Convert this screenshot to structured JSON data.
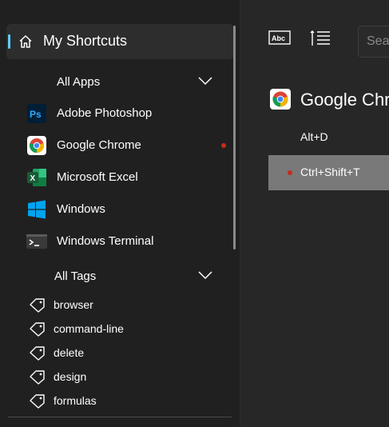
{
  "sidebar": {
    "home": {
      "label": "My Shortcuts",
      "icon": "home-icon"
    },
    "apps_group": {
      "label": "All Apps",
      "icon": "chevron-down-icon"
    },
    "apps": [
      {
        "label": "Adobe Photoshop",
        "icon": "photoshop-icon",
        "has_indicator": false
      },
      {
        "label": "Google Chrome",
        "icon": "chrome-icon",
        "has_indicator": true
      },
      {
        "label": "Microsoft Excel",
        "icon": "excel-icon",
        "has_indicator": false
      },
      {
        "label": "Windows",
        "icon": "windows-icon",
        "has_indicator": false
      },
      {
        "label": "Windows Terminal",
        "icon": "terminal-icon",
        "has_indicator": false
      }
    ],
    "tags_group": {
      "label": "All Tags",
      "icon": "chevron-down-icon"
    },
    "tags": [
      {
        "label": "browser",
        "icon": "tag-icon"
      },
      {
        "label": "command-line",
        "icon": "tag-icon"
      },
      {
        "label": "delete",
        "icon": "tag-icon"
      },
      {
        "label": "design",
        "icon": "tag-icon"
      },
      {
        "label": "formulas",
        "icon": "tag-icon"
      }
    ]
  },
  "toolbar": {
    "view_text_icon": "abc-view-icon",
    "view_list_icon": "list-view-icon",
    "search": {
      "placeholder": "Search",
      "visible_text": "Sea"
    }
  },
  "main": {
    "app_title": "Google Chrome",
    "app_title_visible": "Google Chr",
    "app_icon": "chrome-icon",
    "shortcuts": [
      {
        "keys": "Alt+D",
        "selected": false,
        "has_indicator": false
      },
      {
        "keys": "Ctrl+Shift+T",
        "selected": true,
        "has_indicator": true
      }
    ]
  },
  "colors": {
    "background": "#202020",
    "content_background": "#272727",
    "selected_item": "#2d2d2d",
    "selected_row": "#797979",
    "accent": "#60cdff",
    "indicator_dot": "#c42b1c"
  }
}
